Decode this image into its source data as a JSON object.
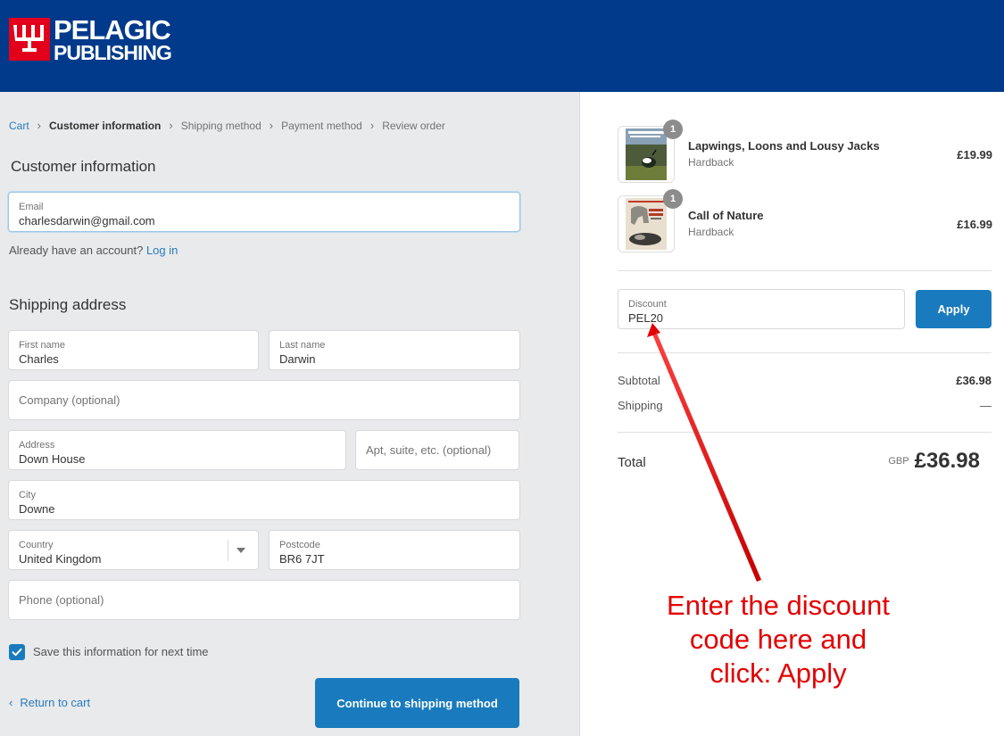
{
  "header": {
    "logo_line1": "PELAGIC",
    "logo_line2": "PUBLISHING",
    "background_color": "#013a8b",
    "logo_color": "#e3001b"
  },
  "breadcrumb": [
    {
      "label": "Cart",
      "state": "link"
    },
    {
      "label": "Customer information",
      "state": "active"
    },
    {
      "label": "Shipping method",
      "state": "inactive"
    },
    {
      "label": "Payment method",
      "state": "inactive"
    },
    {
      "label": "Review order",
      "state": "inactive"
    }
  ],
  "customer": {
    "title": "Customer information",
    "email_label": "Email",
    "email_value": "charlesdarwin@gmail.com",
    "account_prompt": "Already have an account?",
    "login_label": "Log in"
  },
  "shipping": {
    "title": "Shipping address",
    "first_name_label": "First name",
    "first_name_value": "Charles",
    "last_name_label": "Last name",
    "last_name_value": "Darwin",
    "company_placeholder": "Company (optional)",
    "address_label": "Address",
    "address_value": "Down House",
    "apt_placeholder": "Apt, suite, etc. (optional)",
    "city_label": "City",
    "city_value": "Downe",
    "country_label": "Country",
    "country_value": "United Kingdom",
    "postcode_label": "Postcode",
    "postcode_value": "BR6 7JT",
    "phone_placeholder": "Phone (optional)",
    "save_info_label": "Save this information for next time",
    "save_info_checked": true
  },
  "actions": {
    "return_label": "Return to cart",
    "continue_label": "Continue to shipping method"
  },
  "order": {
    "items": [
      {
        "name": "Lapwings, Loons and Lousy Jacks",
        "variant": "Hardback",
        "price": "£19.99",
        "quantity": "1"
      },
      {
        "name": "Call of Nature",
        "variant": "Hardback",
        "price": "£16.99",
        "quantity": "1"
      }
    ],
    "discount_label": "Discount",
    "discount_value": "PEL20",
    "apply_label": "Apply",
    "subtotal_label": "Subtotal",
    "subtotal_value": "£36.98",
    "shipping_label": "Shipping",
    "shipping_value": "—",
    "total_label": "Total",
    "total_currency": "GBP",
    "total_value": "£36.98"
  },
  "annotation": {
    "line1": "Enter the discount",
    "line2": "code here and",
    "line3": "click: Apply",
    "color": "#e30000"
  },
  "accent_color": "#197bbd"
}
